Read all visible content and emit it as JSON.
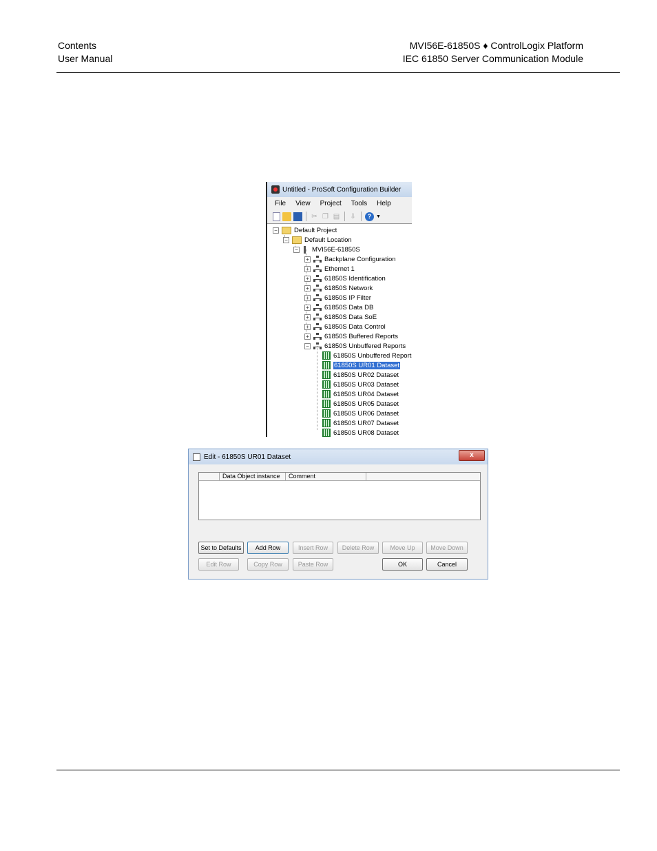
{
  "header": {
    "left_line1": "Contents",
    "left_line2": "User Manual",
    "right_line1": "MVI56E-61850S ♦ ControlLogix Platform",
    "right_line2": "IEC 61850 Server Communication Module"
  },
  "pcb": {
    "title": "Untitled - ProSoft Configuration Builder",
    "menu": [
      "File",
      "View",
      "Project",
      "Tools",
      "Help"
    ],
    "tree": {
      "project": "Default Project",
      "location": "Default Location",
      "module": "MVI56E-61850S",
      "items": [
        "Backplane Configuration",
        "Ethernet 1",
        "61850S Identification",
        "61850S Network",
        "61850S IP Filter",
        "61850S Data DB",
        "61850S Data SoE",
        "61850S Data Control",
        "61850S Buffered Reports",
        "61850S Unbuffered Reports"
      ],
      "sub_items": [
        "61850S Unbuffered Reports",
        "61850S UR01 Dataset",
        "61850S UR02 Dataset",
        "61850S UR03 Dataset",
        "61850S UR04 Dataset",
        "61850S UR05 Dataset",
        "61850S UR06 Dataset",
        "61850S UR07 Dataset",
        "61850S UR08 Dataset"
      ],
      "selected": "61850S UR01 Dataset"
    }
  },
  "dialog": {
    "title": "Edit - 61850S UR01 Dataset",
    "close": "x",
    "columns": [
      "",
      "Data Object instance",
      "Comment",
      ""
    ],
    "buttons_row1": [
      "Set to Defaults",
      "Add Row",
      "Insert Row",
      "Delete Row",
      "Move Up",
      "Move Down"
    ],
    "buttons_row2": [
      "Edit Row",
      "Copy Row",
      "Paste Row",
      "OK",
      "Cancel"
    ]
  }
}
